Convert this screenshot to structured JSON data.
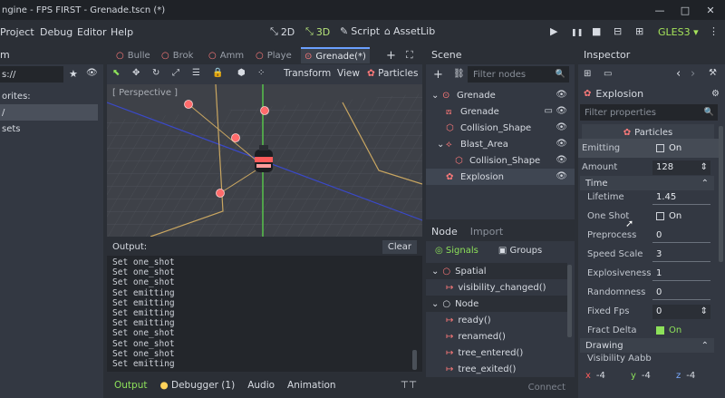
{
  "window": {
    "title": "ngine - FPS FIRST - Grenade.tscn (*)",
    "minimize": "—",
    "maximize": "□",
    "close": "✕"
  },
  "menu": {
    "items": [
      "Project",
      "Debug",
      "Editor",
      "Help"
    ]
  },
  "workspaces": [
    {
      "label": "2D",
      "icon": "2d-icon"
    },
    {
      "label": "3D",
      "icon": "3d-icon",
      "active": true
    },
    {
      "label": "Script",
      "icon": "script-icon"
    },
    {
      "label": "AssetLib",
      "icon": "assetlib-icon"
    }
  ],
  "play": {
    "play": "▶",
    "pause": "❚❚",
    "stop": "■",
    "scene": "⊟",
    "custom": "⊞",
    "renderer": "GLES3",
    "renderer_arrow": "▾"
  },
  "filesystem": {
    "header": "m",
    "path": "s://",
    "favorites": "orites:",
    "root": "/",
    "assets": "sets"
  },
  "viewport": {
    "tabs": [
      "Bulle",
      "Brok",
      "Amm",
      "Playe",
      "Grenade(*)"
    ],
    "add_tab": "+",
    "fullscreen": "⛶",
    "toolbar": {
      "transform": "Transform",
      "view": "View",
      "particles": "Particles"
    },
    "perspective": "[ Perspective ]"
  },
  "output": {
    "title": "Output:",
    "clear": "Clear",
    "lines": [
      "Set one_shot",
      "Set one_shot",
      "Set one_shot",
      "Set emitting",
      "Set emitting",
      "Set emitting",
      "Set emitting",
      "Set one_shot",
      "Set one_shot",
      "Set one_shot",
      "Set emitting"
    ],
    "pin": "⊤⊤"
  },
  "bottom_tabs": {
    "output": "Output",
    "debugger": "Debugger (1)",
    "audio": "Audio",
    "animation": "Animation"
  },
  "scene": {
    "title": "Scene",
    "filter_placeholder": "Filter nodes",
    "add": "+",
    "link": "⛓",
    "search": "🔍",
    "nodes": [
      {
        "label": "Grenade",
        "arrow": "⌄",
        "icon": "⊙",
        "indent": 0
      },
      {
        "label": "Grenade",
        "arrow": "",
        "icon": "⟎",
        "indent": 1,
        "extra": "▭"
      },
      {
        "label": "Collision_Shape",
        "arrow": "",
        "icon": "⬡",
        "indent": 1
      },
      {
        "label": "Blast_Area",
        "arrow": "⌄",
        "icon": "⟡",
        "indent": 1
      },
      {
        "label": "Collision_Shape",
        "arrow": "",
        "icon": "⬡",
        "indent": 2
      },
      {
        "label": "Explosion",
        "arrow": "",
        "icon": "✿",
        "indent": 1
      }
    ],
    "eye": "👁"
  },
  "node": {
    "tab_node": "Node",
    "tab_import": "Import",
    "signals": "Signals",
    "groups": "Groups",
    "rows": [
      {
        "label": "Spatial",
        "cat": true
      },
      {
        "label": "visibility_changed()",
        "cat": false
      },
      {
        "label": "Node",
        "cat": true
      },
      {
        "label": "ready()",
        "cat": false
      },
      {
        "label": "renamed()",
        "cat": false
      },
      {
        "label": "tree_entered()",
        "cat": false
      },
      {
        "label": "tree_exited()",
        "cat": false
      }
    ],
    "connect": "Connect"
  },
  "inspector": {
    "title": "Inspector",
    "node_name": "Explosion",
    "filter_placeholder": "Filter properties",
    "class_name": "Particles",
    "nav_back": "‹",
    "nav_fwd": "›",
    "props_top": [
      {
        "label": "Emitting",
        "value": "On",
        "type": "check",
        "checked": false
      },
      {
        "label": "Amount",
        "value": "128",
        "type": "spin"
      }
    ],
    "section_time": "Time",
    "props_time": [
      {
        "label": "Lifetime",
        "value": "1.45",
        "type": "num"
      },
      {
        "label": "One Shot",
        "value": "On",
        "type": "check",
        "checked": false
      },
      {
        "label": "Preprocess",
        "value": "0",
        "type": "num"
      },
      {
        "label": "Speed Scale",
        "value": "3",
        "type": "num"
      },
      {
        "label": "Explosiveness",
        "value": "1",
        "type": "num"
      },
      {
        "label": "Randomness",
        "value": "0",
        "type": "num"
      },
      {
        "label": "Fixed Fps",
        "value": "0",
        "type": "spin"
      },
      {
        "label": "Fract Delta",
        "value": "On",
        "type": "check",
        "checked": true
      }
    ],
    "section_drawing": "Drawing",
    "visibility_aabb": "Visibility Aabb",
    "aabb": [
      {
        "axis": "x",
        "value": "-4"
      },
      {
        "axis": "y",
        "value": "-4"
      },
      {
        "axis": "z",
        "value": "-4"
      }
    ],
    "axis_colors": {
      "x": "#ff5c5c",
      "y": "#8de15a",
      "z": "#7aaaff"
    }
  }
}
